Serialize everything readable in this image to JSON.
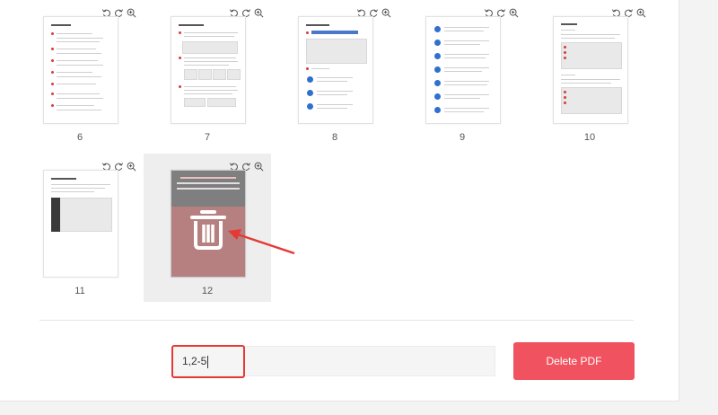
{
  "pages": [
    {
      "number": "6"
    },
    {
      "number": "7"
    },
    {
      "number": "8"
    },
    {
      "number": "9"
    },
    {
      "number": "10"
    },
    {
      "number": "11"
    },
    {
      "number": "12",
      "marked_for_deletion": true
    }
  ],
  "thumbnail_tools": [
    "rotate-left-icon",
    "rotate-right-icon",
    "zoom-in-icon"
  ],
  "range_input": {
    "value": "1,2-5"
  },
  "delete_button": {
    "label": "Delete PDF"
  },
  "colors": {
    "delete_button": "#f1525f",
    "highlight_box": "#e53935",
    "deleted_overlay": "#b68080",
    "card_selected": "#eeeeee"
  }
}
